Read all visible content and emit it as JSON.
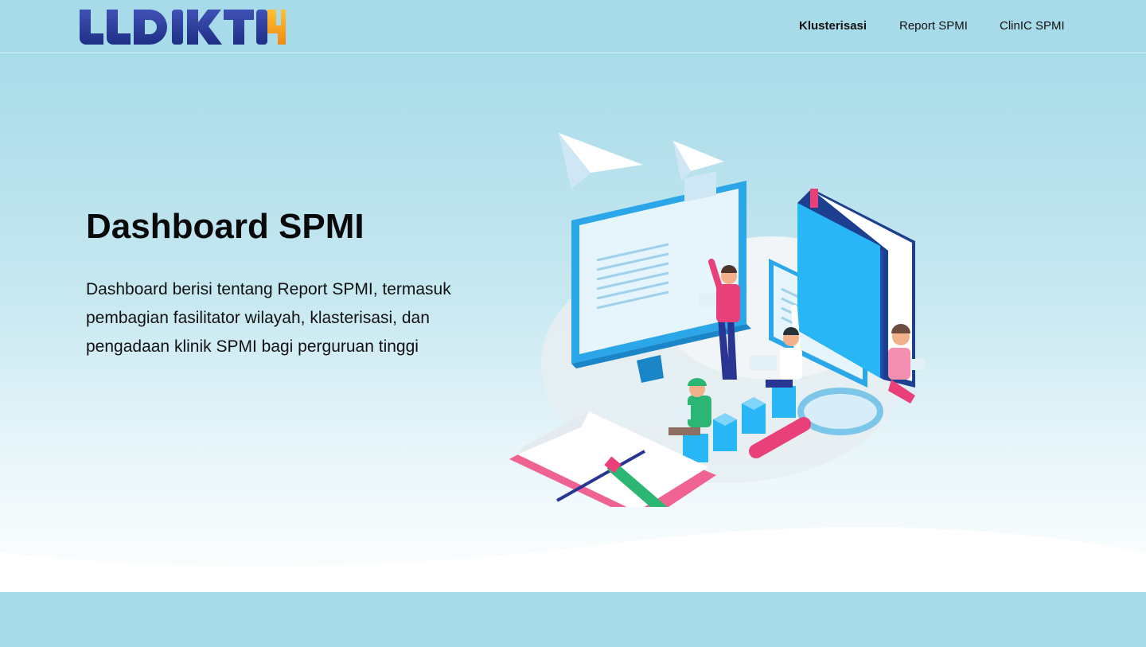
{
  "brand": {
    "logo_text": "LLDIKTI",
    "logo_number": "4"
  },
  "nav": {
    "items": [
      {
        "label": "Klusterisasi",
        "active": true
      },
      {
        "label": "Report SPMI",
        "active": false
      },
      {
        "label": "ClinIC SPMI",
        "active": false
      }
    ]
  },
  "hero": {
    "title": "Dashboard SPMI",
    "description": "Dashboard berisi tentang Report SPMI, termasuk pembagian fasilitator wilayah, klasterisasi, dan pengadaan klinik SPMI bagi perguruan tinggi"
  },
  "illustration": {
    "icon": "education-dashboard-illustration"
  },
  "colors": {
    "background": "#a8dbe9",
    "logo_blue": "#283593",
    "logo_orange": "#f7a51c",
    "text": "#111111",
    "screen_blue": "#2ba6e8",
    "accent_pink": "#e9407a",
    "accent_green": "#2bb673"
  }
}
